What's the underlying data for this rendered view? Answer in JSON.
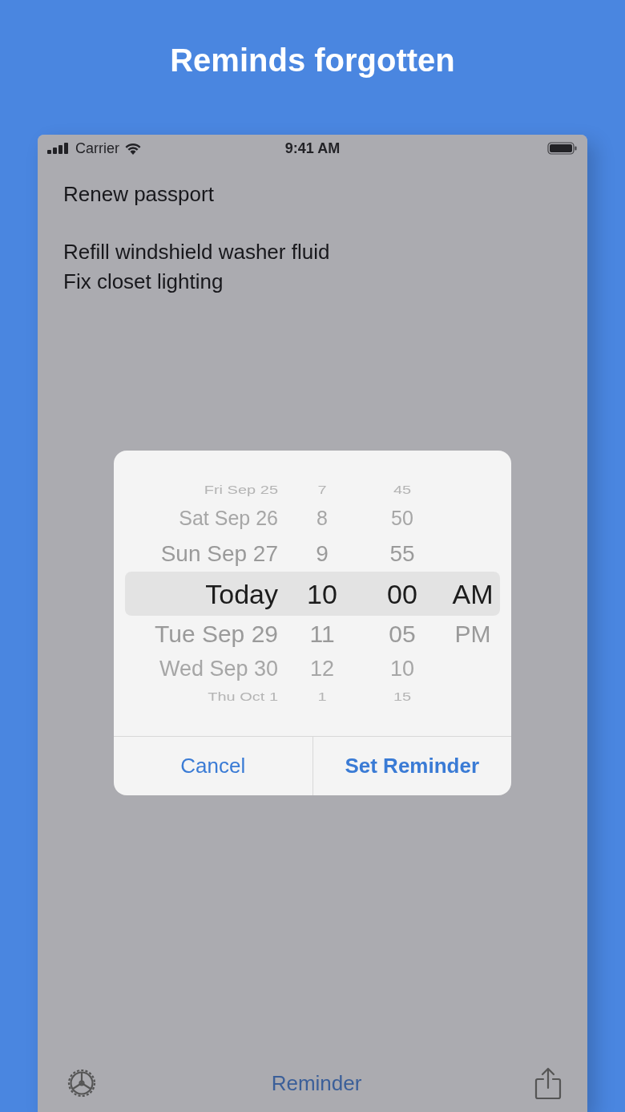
{
  "title": "Reminds forgotten",
  "status_bar": {
    "carrier": "Carrier",
    "time": "9:41 AM"
  },
  "notes": [
    {
      "lines": [
        "Renew passport"
      ]
    },
    {
      "lines": [
        "Refill windshield washer fluid",
        "Fix closet lighting"
      ]
    }
  ],
  "picker": {
    "columns": [
      {
        "items": [
          {
            "label": "Fri Sep 25",
            "selected": false
          },
          {
            "label": "Sat Sep 26",
            "selected": false
          },
          {
            "label": "Sun Sep 27",
            "selected": false
          },
          {
            "label": "Today",
            "selected": true
          },
          {
            "label": "Tue Sep 29",
            "selected": false
          },
          {
            "label": "Wed Sep 30",
            "selected": false
          },
          {
            "label": "Thu Oct 1",
            "selected": false
          }
        ]
      },
      {
        "items": [
          {
            "label": "7",
            "selected": false
          },
          {
            "label": "8",
            "selected": false
          },
          {
            "label": "9",
            "selected": false
          },
          {
            "label": "10",
            "selected": true
          },
          {
            "label": "11",
            "selected": false
          },
          {
            "label": "12",
            "selected": false
          },
          {
            "label": "1",
            "selected": false
          }
        ]
      },
      {
        "items": [
          {
            "label": "45",
            "selected": false
          },
          {
            "label": "50",
            "selected": false
          },
          {
            "label": "55",
            "selected": false
          },
          {
            "label": "00",
            "selected": true
          },
          {
            "label": "05",
            "selected": false
          },
          {
            "label": "10",
            "selected": false
          },
          {
            "label": "15",
            "selected": false
          }
        ]
      },
      {
        "items": [
          {
            "label": "AM",
            "selected": true
          },
          {
            "label": "PM",
            "selected": false
          }
        ]
      }
    ]
  },
  "buttons": [
    {
      "label": "Cancel",
      "kind": "secondary"
    },
    {
      "label": "Set Reminder",
      "kind": "primary"
    }
  ],
  "toolbar": {
    "title": "Reminder"
  }
}
